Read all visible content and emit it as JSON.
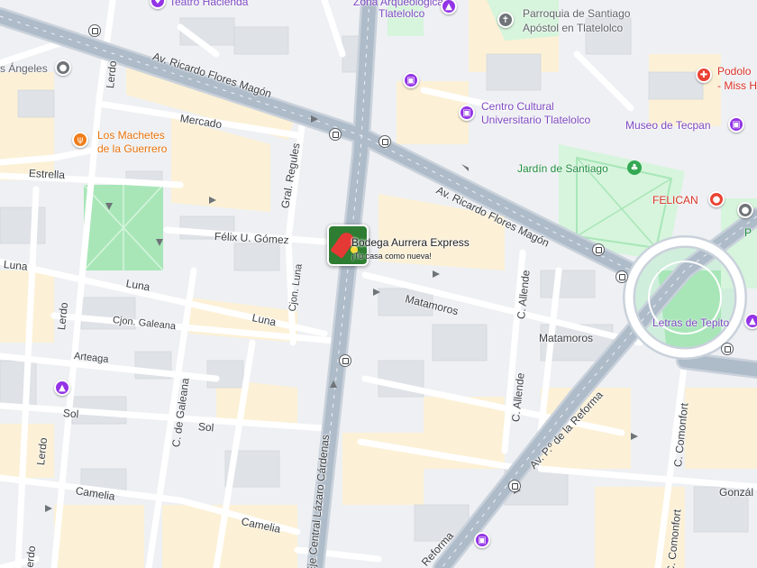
{
  "map": {
    "colors": {
      "background": "#eef0f3",
      "block": "#e3e5e9",
      "building": "#dcdfe4",
      "commercial": "#fcf1d6",
      "park": "#a8e6b8",
      "park_light": "#d6f5dc",
      "road": "#ffffff",
      "arterial": "#aebbc9",
      "road_casing": "#c9d1db"
    },
    "streets": {
      "flores_magon_west": "Av. Ricardo Flores Magón",
      "flores_magon_east": "Av. Ricardo Flores Magón",
      "mercado": "Mercado",
      "estrella": "Estrella",
      "felix_gomez": "Félix U. Gómez",
      "luna_west": "Luna",
      "luna_east": "Luna",
      "cjon_luna": "Cjon. Luna",
      "cjon_galeana": "Cjon. Galeana",
      "arteaga": "Arteaga",
      "sol_west": "Sol",
      "sol_east": "Sol",
      "c_de_galeana": "C. de Galeana",
      "camelia_west": "Camelia",
      "camelia_east": "Camelia",
      "lerdo_1": "Lerdo",
      "lerdo_2": "Lerdo",
      "lerdo_3": "Lerdo",
      "lerdo_4": "Lerdo",
      "gral_regules": "Gral. Regules",
      "eje_central": "Eje Central Lázaro Cárdenas",
      "matamoros_1": "Matamoros",
      "matamoros_2": "Matamoros",
      "c_allende_1": "C. Allende",
      "c_allende_2": "C. Allende",
      "reforma_1": "Av. P.º de la Reforma",
      "reforma_2": "Reforma",
      "c_comonfort_1": "C. Comonfort",
      "c_comonfort_2": "C. Comonfort",
      "gonzalez": "Gonzál"
    },
    "pois": {
      "teatro": "Teatro Hacienda",
      "zona_arq": "Zona Arqueológica",
      "tlatelolco": "Tlatelolco",
      "parroquia_1": "Parroquia de Santiago",
      "parroquia_2": "Apóstol en Tlatelolco",
      "angeles": "s Ángeles",
      "machetes_1": "Los Machetes",
      "machetes_2": "de la Guerrero",
      "centro_1": "Centro Cultural",
      "centro_2": "Universitario Tlatelolco",
      "museo": "Museo de Tecpan",
      "jardin": "Jardín de Santiago",
      "felican": "FELICAN",
      "podologo_1": "Podolo",
      "podologo_2": "- Miss H",
      "letras": "Letras de Tepito",
      "edge_p": "P"
    },
    "selected_place": {
      "name": "Bodega Aurrera Express",
      "tagline": "¡Tu casa como nueva!"
    }
  }
}
